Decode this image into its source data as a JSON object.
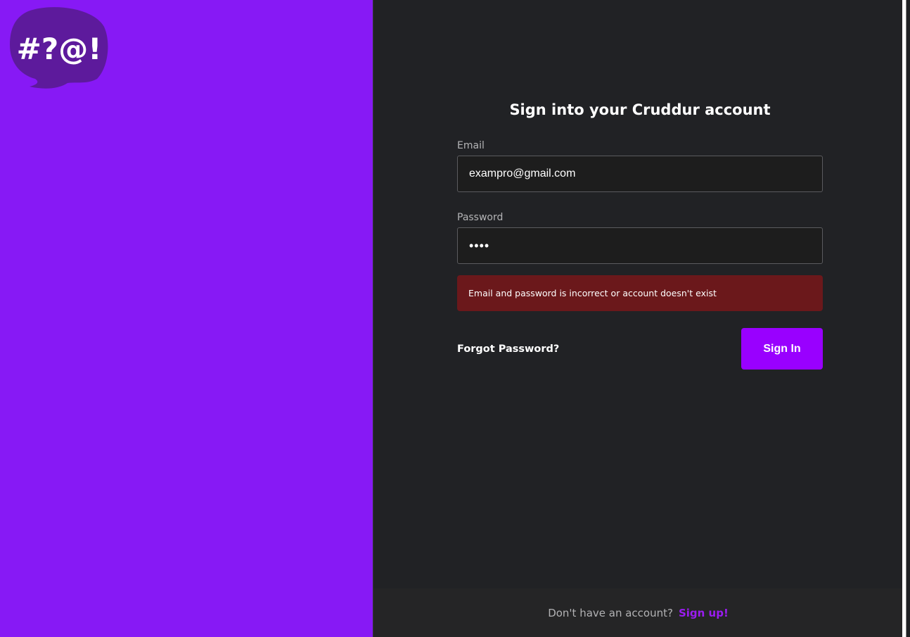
{
  "brand": {
    "logo_text": "#?@!",
    "logo_icon": "speech-bubble-icon",
    "left_panel_color": "#8719f5",
    "logo_bubble_color": "#5d1a9c"
  },
  "signin": {
    "title": "Sign into your Cruddur account",
    "email_label": "Email",
    "email_value": "exampro@gmail.com",
    "password_label": "Password",
    "password_value": "••••",
    "error_message": "Email and password is incorrect or account doesn't exist",
    "forgot_label": "Forgot Password?",
    "submit_label": "Sign In"
  },
  "footer": {
    "prompt": "Don't have an account?",
    "signup_label": "Sign up!"
  },
  "colors": {
    "accent": "#9900ff",
    "error_bg": "#6b181b",
    "panel_bg": "#212225"
  }
}
